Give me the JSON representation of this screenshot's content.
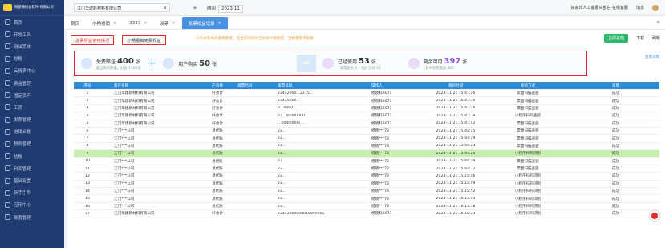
{
  "sidebar": {
    "logo_text": "畅捷通财会软件 有限公司",
    "items": [
      "首页",
      "开发工具",
      "测试菜单",
      "总账",
      "云报表中心",
      "资金管理",
      "固定资产",
      "工资",
      "发票管理",
      "进销台账",
      "税务管理",
      "结账",
      "利润管理",
      "基础设置",
      "新手引导",
      "应用中心",
      "账套管理"
    ]
  },
  "topbar": {
    "company": "江门华建新材料有限公司",
    "company_caret": "∨",
    "add": "+",
    "period_label": "期间",
    "period_value": "2023-11",
    "help": "好会计人工客服头部右·在线客服",
    "messages": "消息"
  },
  "tabs": [
    {
      "label": "首页",
      "active": false
    },
    {
      "label": "小畅报销",
      "active": false
    },
    {
      "label": "3333",
      "active": false
    },
    {
      "label": "发票",
      "active": false
    },
    {
      "label": "发票权益记录",
      "active": true
    }
  ],
  "tabs_more": "≡",
  "subtabs": {
    "usage": "发票权益使用情况",
    "mobile": "小畅报销免费权益"
  },
  "hint": "小仅本软件外使用数量，在当前时间的当好会计赠额度，当数量需不能数",
  "actions": {
    "open": "立即充值",
    "download": "下载",
    "refresh": "刷新"
  },
  "stats": {
    "free": {
      "label": "免费赠送",
      "count": "400",
      "unit": "张",
      "sub": "超出购买数量，好会计200张"
    },
    "plus": "+",
    "bought": {
      "label": "用户购买",
      "count": "50",
      "unit": "张"
    },
    "equals": "=",
    "used": {
      "label": "已经使用",
      "count": "53",
      "unit": "张",
      "sub1": "· 发票查验",
      "sub1_val": "0",
      "sub2": "· 图片识别",
      "sub2_val": "53"
    },
    "remain": {
      "label": "剩余可用",
      "count": "397",
      "unit": "张",
      "sub": "· 其中免费赠送",
      "sub_val": "360"
    },
    "more": "查看详情"
  },
  "table": {
    "headers": [
      "序号",
      "客户名称",
      "产品线",
      "发票代码",
      "发票号码",
      "操作人",
      "查验时间",
      "查验方式",
      "说明"
    ],
    "rows": [
      [
        "1",
        "江门华建新材料有限公司",
        "好会计",
        "",
        "23442000…2275…",
        "杨晓科3073",
        "2023-11-21 15:41:26",
        "票面扫描查验",
        "成功"
      ],
      [
        "2",
        "江门华建新材料有限公司",
        "好会计",
        "",
        "23440000…",
        "杨晓科3073",
        "2023-11-21 15:41:30",
        "票面扫描查验",
        "成功"
      ],
      [
        "3",
        "江门华建新材料有限公司",
        "好会计",
        "",
        "2…0000…",
        "杨晓科3073",
        "2023-11-21 15:41:34",
        "票面扫描查验",
        "成功"
      ],
      [
        "4",
        "江门华建新材料有限公司",
        "好会计",
        "",
        "23…00000000…",
        "杨晓科3073",
        "2023-11-21 15:41:39",
        "小程序扫码查验",
        "成功"
      ],
      [
        "5",
        "江门华建新材料有限公司",
        "好会计",
        "",
        "…00000000…",
        "杨晓科3073",
        "2023-11-21 15:41:42",
        "票面扫描查验",
        "成功"
      ],
      [
        "6",
        "江门***公司",
        "易代账",
        "",
        "23…",
        "杨晓***73",
        "2023-11-21 15:44:15",
        "票面扫描查验",
        "成功"
      ],
      [
        "7",
        "江门***公司",
        "易代账",
        "",
        "23…",
        "杨晓***73",
        "2023-11-21 15:44:19",
        "票面扫描查验",
        "成功"
      ],
      [
        "8",
        "江门***公司",
        "易代账",
        "",
        "23…",
        "杨晓***73",
        "2023-11-21 15:44:23",
        "票面扫描查验",
        "成功"
      ],
      [
        "9",
        "江门***公司",
        "易代账",
        "",
        "23…",
        "杨晓***73",
        "2023-11-21 15:44:26",
        "小程序扫码识别",
        "成功"
      ],
      [
        "10",
        "江门***公司",
        "易代账",
        "",
        "23…",
        "杨晓***73",
        "2023-11-21 15:44:29",
        "票面扫描查验",
        "成功"
      ],
      [
        "11",
        "江门***公司",
        "易代账",
        "",
        "23…",
        "杨晓***73",
        "2023-11-21 15:44:32",
        "票面扫描查验",
        "成功"
      ],
      [
        "12",
        "江门***公司",
        "易代账",
        "",
        "23…",
        "杨晓***73",
        "2023-11-21 15:15:46",
        "小程序扫码识别",
        "成功"
      ],
      [
        "13",
        "江门***公司",
        "易代账",
        "",
        "23…",
        "杨晓***73",
        "2023-11-21 15:15:49",
        "小程序扫码识别",
        "成功"
      ],
      [
        "14",
        "江门***公司",
        "易代账",
        "",
        "23…",
        "杨晓***73",
        "2023-11-21 15:15:52",
        "小程序扫码识别",
        "成功"
      ],
      [
        "15",
        "江门***公司",
        "易代账",
        "",
        "23…",
        "杨晓***73",
        "2023-11-21 16:15:55",
        "小程序扫码识别",
        "成功"
      ],
      [
        "16",
        "江门***公司",
        "易代账",
        "",
        "23…",
        "杨晓***73",
        "2023-11-21 16:15:58",
        "小程序扫码识别",
        "成功"
      ],
      [
        "17",
        "江门华建新材料有限公司",
        "好会计",
        "",
        "23442000000018959001",
        "杨晓科3073",
        "2023-11-21 16:16:23",
        "小程序扫码识别",
        "成功"
      ]
    ],
    "highlight_row": 8
  },
  "colors": {
    "sidebar": "#1f3b70",
    "accent": "#4a90e2",
    "header": "#2e8bd6",
    "highlight": "#c8eeb0",
    "annotation": "#e52a2a"
  }
}
